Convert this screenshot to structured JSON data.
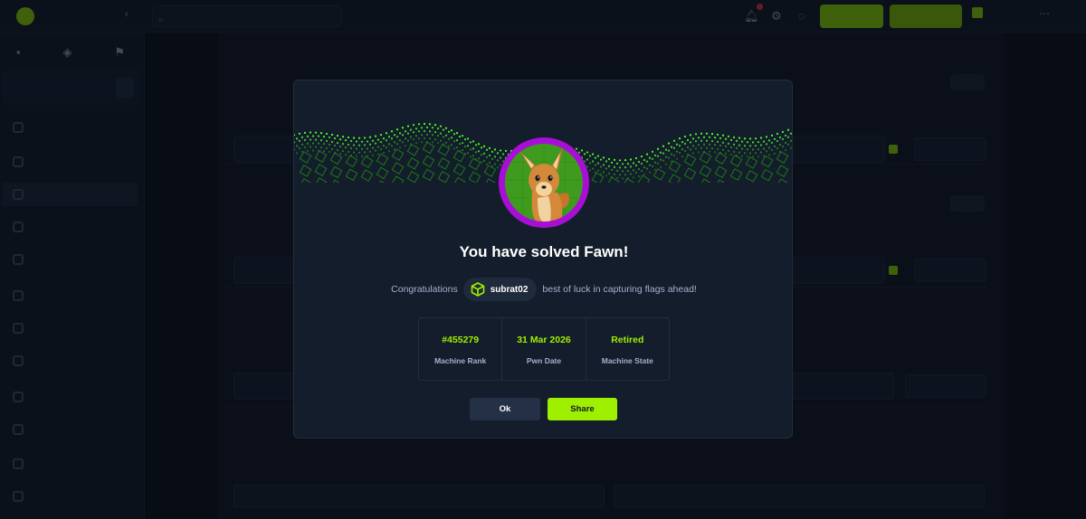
{
  "modal": {
    "title": "You have solved Fawn!",
    "congrats_prefix": "Congratulations",
    "username": "subrat02",
    "congrats_suffix": "best of luck in capturing flags ahead!",
    "stats": [
      {
        "value": "#455279",
        "label": "Machine Rank"
      },
      {
        "value": "31 Mar 2026",
        "label": "Pwn Date"
      },
      {
        "value": "Retired",
        "label": "Machine State"
      }
    ],
    "ok_label": "Ok",
    "share_label": "Share"
  },
  "colors": {
    "accent": "#9fef00",
    "avatar_ring": "#a80ed6",
    "modal_bg": "#141d2b"
  },
  "icons": {
    "user_badge": "green-cube-icon",
    "avatar": "fawn-deer-avatar"
  }
}
